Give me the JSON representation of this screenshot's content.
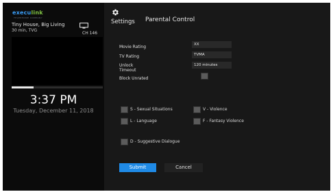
{
  "brand": {
    "name_part1": "execu",
    "name_part2": "link",
    "tagline": "TELEPHONE COMPANY"
  },
  "now_playing": {
    "title": "Tiny House, Big Living",
    "meta": "30 min, TVG",
    "channel": "CH 146",
    "progress_fraction": 0.24
  },
  "clock": {
    "time": "3:37 PM",
    "date": "Tuesday, December 11, 2018"
  },
  "header": {
    "settings_label": "Settings",
    "title": "Parental Control"
  },
  "form": {
    "movie_rating": {
      "label": "Movie Rating",
      "value": "XX"
    },
    "tv_rating": {
      "label": "TV Rating",
      "value": "TVMA"
    },
    "unlock_timeout": {
      "label_line1": "Unlock",
      "label_line2": "Timeout",
      "value": "120 minutes"
    },
    "block_unrated": {
      "label": "Block Unrated"
    }
  },
  "content_filters": {
    "sexual": "S - Sexual Situations",
    "violence": "V - Violence",
    "language": "L - Language",
    "fantasy": "F - Fantasy Violence",
    "dialogue": "D - Suggestive Dialogue"
  },
  "buttons": {
    "submit": "Submit",
    "cancel": "Cancel"
  },
  "colors": {
    "accent": "#1f8ae6",
    "brand_blue": "#3a9cf5",
    "brand_green": "#7fc243"
  }
}
